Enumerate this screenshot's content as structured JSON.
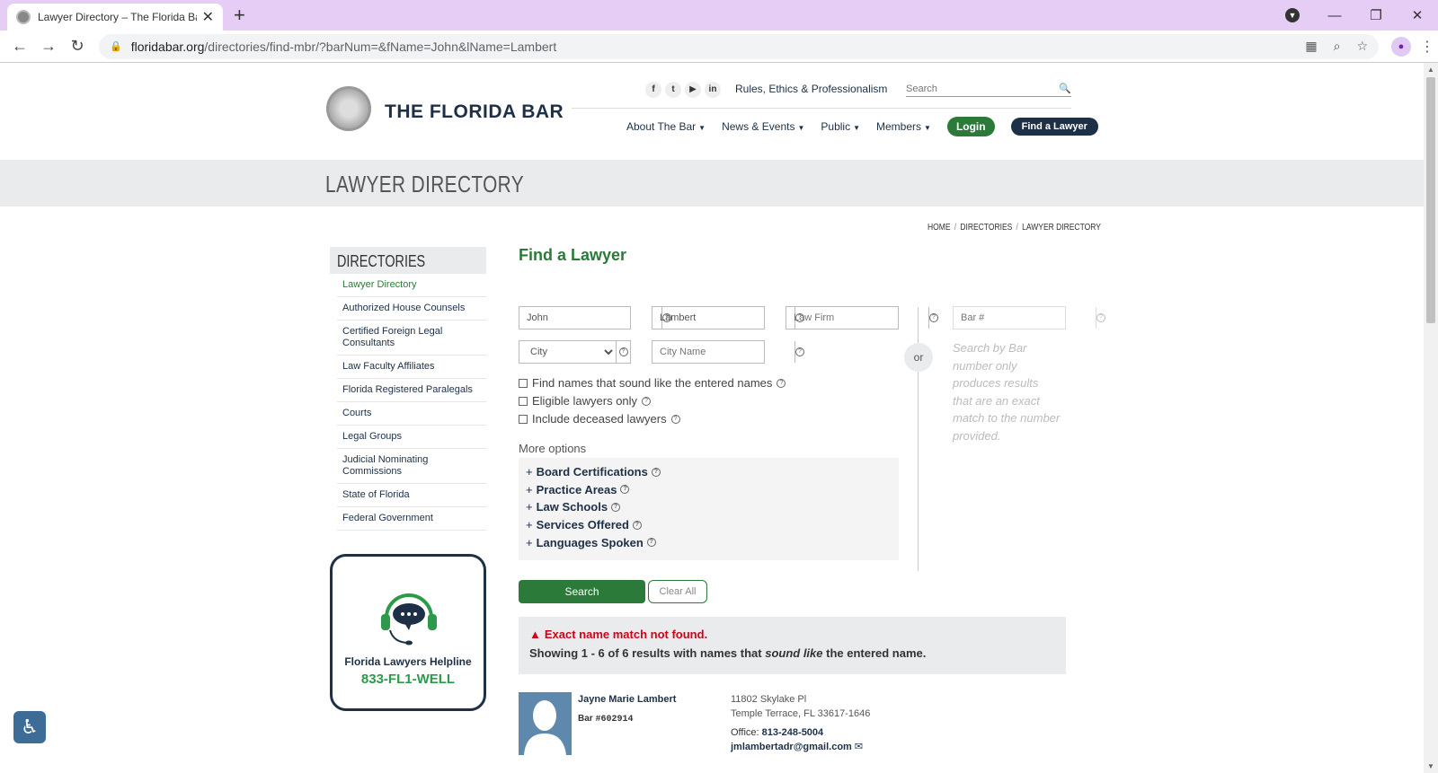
{
  "browser": {
    "tab_title": "Lawyer Directory – The Florida Ba",
    "url_host": "floridabar.org",
    "url_path": "/directories/find-mbr/?barNum=&fName=John&lName=Lambert"
  },
  "header": {
    "brand": "THE FLORIDA BAR",
    "social": [
      "f",
      "t",
      "▶",
      "in"
    ],
    "rules_link": "Rules, Ethics & Professionalism",
    "search_placeholder": "Search",
    "nav": [
      {
        "label": "About The Bar"
      },
      {
        "label": "News & Events"
      },
      {
        "label": "Public"
      },
      {
        "label": "Members"
      }
    ],
    "login": "Login",
    "find_lawyer": "Find a Lawyer"
  },
  "banner": {
    "title": "LAWYER DIRECTORY"
  },
  "breadcrumb": [
    "HOME",
    "DIRECTORIES",
    "LAWYER DIRECTORY"
  ],
  "sidebar": {
    "heading": "DIRECTORIES",
    "items": [
      "Lawyer Directory",
      "Authorized House Counsels",
      "Certified Foreign Legal Consultants",
      "Law Faculty Affiliates",
      "Florida Registered Paralegals",
      "Courts",
      "Legal Groups",
      "Judicial Nominating Commissions",
      "State of Florida",
      "Federal Government"
    ],
    "helpline_title": "Florida Lawyers Helpline",
    "helpline_number": "833-FL1-WELL"
  },
  "form": {
    "title": "Find a Lawyer",
    "first_name": "John",
    "last_name": "Lambert",
    "firm_placeholder": "Law Firm",
    "city_select": "City",
    "city_placeholder": "City Name",
    "bar_placeholder": "Bar #",
    "or": "or",
    "bar_hint": "Search by Bar number only produces results that are an exact match to the number provided.",
    "checks": [
      "Find names that sound like the entered names",
      "Eligible lawyers only",
      "Include deceased lawyers"
    ],
    "more_options": "More options",
    "options": [
      "Board Certifications",
      "Practice Areas",
      "Law Schools",
      "Services Offered",
      "Languages Spoken"
    ],
    "search_btn": "Search",
    "clear_btn": "Clear All"
  },
  "alert": {
    "error": "Exact name match not found.",
    "msg_pre": "Showing 1 - 6 of 6 results with names that ",
    "msg_em": "sound like",
    "msg_post": " the entered name."
  },
  "result": {
    "name": "Jayne Marie Lambert",
    "bar_label": "Bar ",
    "bar_num": "#602914",
    "addr1": "11802 Skylake Pl",
    "addr2": "Temple Terrace, FL 33617-1646",
    "office_label": "Office: ",
    "phone": "813-248-5004",
    "email": "jmlambertadr@gmail.com"
  }
}
